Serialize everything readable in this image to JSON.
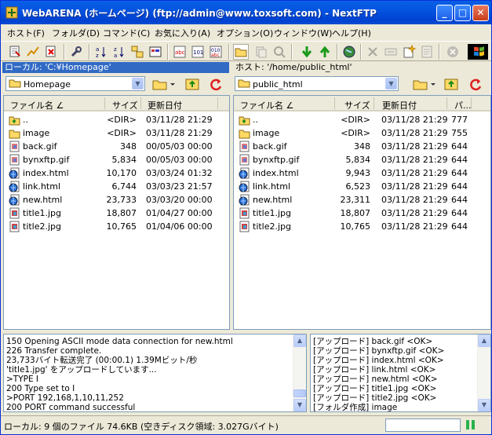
{
  "window": {
    "title": "WebARENA (ホームページ) (ftp://admin@www.toxsoft.com) - NextFTP",
    "minimize_icon": "minimize-icon",
    "maximize_icon": "maximize-icon",
    "close_icon": "close-icon"
  },
  "menu": [
    "ホスト(F)",
    "フォルダ(D)",
    "コマンド(C)",
    "お気に入り(A)",
    "オプション(O)",
    "ウィンドウ(W)",
    "ヘルプ(H)"
  ],
  "toolbar": {
    "icons": [
      "connect-icon",
      "edit-icon",
      "disconnect-icon",
      "settings-icon",
      "sort-asc-icon",
      "sort-desc-icon",
      "tree-icon",
      "view-icon",
      "mode-a-icon",
      "mode-b-icon",
      "mode-c-icon",
      "open-folder-icon",
      "copy-icon",
      "find-icon",
      "download-icon",
      "upload-icon",
      "globe-icon",
      "delete-icon",
      "rename-icon",
      "new-icon",
      "properties-icon",
      "stop-icon",
      "windows-logo-icon"
    ]
  },
  "local": {
    "path_label": "ローカル: 'C:¥Homepage'",
    "folder": "Homepage",
    "columns": [
      "ファイル名 ∠",
      "サイズ",
      "更新日付"
    ],
    "files": [
      {
        "icon": "parent-folder-icon",
        "name": "..",
        "size": "<DIR>",
        "date": "03/11/28 21:29"
      },
      {
        "icon": "folder-icon",
        "name": "image",
        "size": "<DIR>",
        "date": "03/11/28 21:29"
      },
      {
        "icon": "gif-file-icon",
        "name": "back.gif",
        "size": "348",
        "date": "00/05/03 00:00"
      },
      {
        "icon": "gif-file-icon",
        "name": "bynxftp.gif",
        "size": "5,834",
        "date": "00/05/03 00:00"
      },
      {
        "icon": "html-file-icon",
        "name": "index.html",
        "size": "10,170",
        "date": "03/03/24 01:32"
      },
      {
        "icon": "html-file-icon",
        "name": "link.html",
        "size": "6,744",
        "date": "03/03/23 21:57"
      },
      {
        "icon": "html-file-icon",
        "name": "new.html",
        "size": "23,733",
        "date": "03/03/20 00:00"
      },
      {
        "icon": "jpg-file-icon",
        "name": "title1.jpg",
        "size": "18,807",
        "date": "01/04/27 00:00"
      },
      {
        "icon": "jpg-file-icon",
        "name": "title2.jpg",
        "size": "10,765",
        "date": "01/04/06 00:00"
      }
    ]
  },
  "remote": {
    "path_label": "ホスト: '/home/public_html'",
    "folder": "public_html",
    "columns": [
      "ファイル名 ∠",
      "サイズ",
      "更新日付",
      "パ..."
    ],
    "files": [
      {
        "icon": "parent-folder-icon",
        "name": "..",
        "size": "<DIR>",
        "date": "03/11/28 21:29",
        "perm": "777"
      },
      {
        "icon": "folder-icon",
        "name": "image",
        "size": "<DIR>",
        "date": "03/11/28 21:29",
        "perm": "755"
      },
      {
        "icon": "gif-file-icon",
        "name": "back.gif",
        "size": "348",
        "date": "03/11/28 21:29",
        "perm": "644"
      },
      {
        "icon": "gif-file-icon",
        "name": "bynxftp.gif",
        "size": "5,834",
        "date": "03/11/28 21:29",
        "perm": "644"
      },
      {
        "icon": "html-file-icon",
        "name": "index.html",
        "size": "9,943",
        "date": "03/11/28 21:29",
        "perm": "644"
      },
      {
        "icon": "html-file-icon",
        "name": "link.html",
        "size": "6,523",
        "date": "03/11/28 21:29",
        "perm": "644"
      },
      {
        "icon": "html-file-icon",
        "name": "new.html",
        "size": "23,311",
        "date": "03/11/28 21:29",
        "perm": "644"
      },
      {
        "icon": "jpg-file-icon",
        "name": "title1.jpg",
        "size": "18,807",
        "date": "03/11/28 21:29",
        "perm": "644"
      },
      {
        "icon": "jpg-file-icon",
        "name": "title2.jpg",
        "size": "10,765",
        "date": "03/11/28 21:29",
        "perm": "644"
      }
    ]
  },
  "log_left": [
    "150 Opening ASCII mode data connection for new.html",
    "226 Transfer complete.",
    "23,733バイト転送完了 (00:00.1) 1.39Mビット/秒",
    "'title1.jpg' をアップロードしています...",
    ">TYPE I",
    "200 Type set to I",
    ">PORT 192,168,1,10,11,252",
    "200 PORT command successful"
  ],
  "log_right": [
    "[アップロード] back.gif <OK>",
    "[アップロード] bynxftp.gif <OK>",
    "[アップロード] index.html <OK>",
    "[アップロード] link.html <OK>",
    "[アップロード] new.html <OK>",
    "[アップロード] title1.jpg <OK>",
    "[アップロード] title2.jpg <OK>",
    "[フォルダ作成] image"
  ],
  "status": {
    "text": "ローカル: 9 個のファイル  74.6KB  (空きディスク領域: 3.027Gバイト)"
  },
  "colors": {
    "selection": "#316ac5",
    "titlebar": "#0454e0",
    "face": "#ece9d8"
  }
}
